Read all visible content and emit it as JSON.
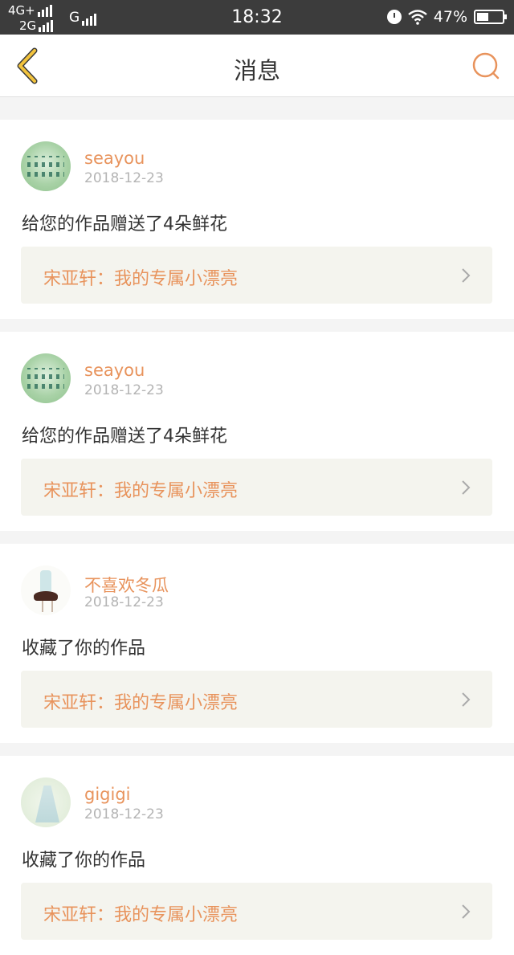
{
  "status_bar": {
    "network_top": "4G+",
    "network_bottom": "2G",
    "carrier_g": "G",
    "time": "18:32",
    "battery_percent": "47%",
    "battery_level": 0.47,
    "icons": [
      "alarm-icon",
      "wifi-icon",
      "battery-icon"
    ]
  },
  "nav": {
    "title": "消息",
    "back_icon": "chevron-left-icon",
    "search_icon": "search-icon"
  },
  "colors": {
    "accent": "#e8935c",
    "back_arrow": "#f2c33d",
    "status_bar": "#3c3c3c",
    "card_box": "#f4f4ee"
  },
  "messages": [
    {
      "username": "seayou",
      "date": "2018-12-23",
      "text": "给您的作品赠送了4朵鲜花",
      "work": "宋亚轩：我的专属小漂亮",
      "avatar": "green-pattern"
    },
    {
      "username": "seayou",
      "date": "2018-12-23",
      "text": "给您的作品赠送了4朵鲜花",
      "work": "宋亚轩：我的专属小漂亮",
      "avatar": "green-pattern"
    },
    {
      "username": "不喜欢冬瓜",
      "date": "2018-12-23",
      "text": "收藏了你的作品",
      "work": "宋亚轩：我的专属小漂亮",
      "avatar": "girl-illustration"
    },
    {
      "username": "gigigi",
      "date": "2018-12-23",
      "text": "收藏了你的作品",
      "work": "宋亚轩：我的专属小漂亮",
      "avatar": "dress-ink"
    }
  ]
}
